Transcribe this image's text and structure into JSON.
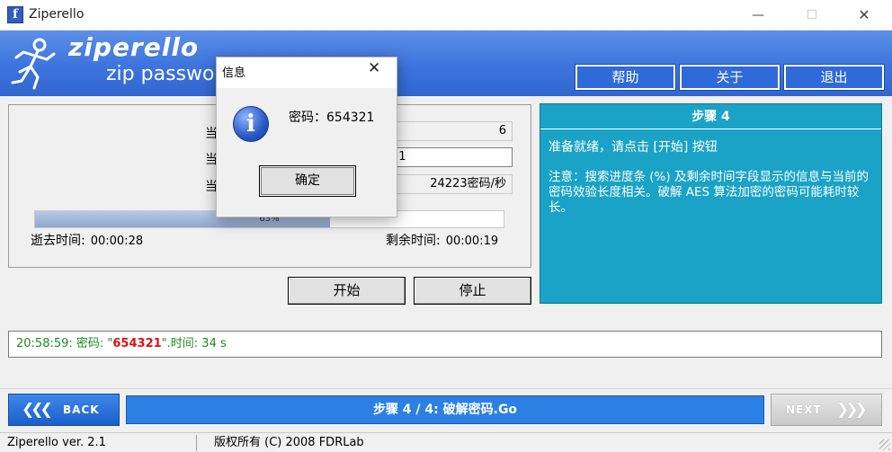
{
  "window": {
    "title": "Ziperello",
    "minimize": "—",
    "maximize": "☐",
    "close": "✕"
  },
  "header": {
    "logo": "ziperello",
    "tagline": "zip password",
    "buttons": {
      "help": "帮助",
      "about": "关于",
      "exit": "退出"
    }
  },
  "stats": {
    "row1_label": "当",
    "row1_value": "6",
    "row2_label": "当",
    "row2_value": "21",
    "row3_label": "当",
    "row3_value": "24223密码/秒",
    "progress_text": "63%",
    "progress_value": 0.63,
    "elapsed_label": "逝去时间:",
    "elapsed_value": "00:00:28",
    "remaining_label": "剩余时间:",
    "remaining_value": "00:00:19"
  },
  "actions": {
    "start": "开始",
    "stop": "停止"
  },
  "step_panel": {
    "title": "步骤 4",
    "instruction": "准备就绪，请点击 [开始] 按钮",
    "note": "注意：搜索进度条 (%) 及剩余时间字段显示的信息与当前的密码效验长度相关。破解 AES 算法加密的密码可能耗时较长。"
  },
  "log": {
    "time": "20:58:59:",
    "prefix": " 密码: \"",
    "password": "654321",
    "suffix": "\".时间: 34 s"
  },
  "nav": {
    "back": "BACK",
    "back_arrows": "❮❮❮",
    "step": "步骤 4 / 4: 破解密码.Go",
    "next": "NEXT",
    "next_arrows": "❯❯❯"
  },
  "status": {
    "version": "Ziperello ver. 2.1",
    "copyright": "版权所有 (C) 2008 FDRLab"
  },
  "dialog": {
    "title": "信息",
    "close": "✕",
    "icon": "info-icon",
    "message": "密码：654321",
    "ok": "确定"
  },
  "colors": {
    "banner": "#3d74dd",
    "step_panel": "#1aa3c6",
    "step_bar": "#2d80e3",
    "log_text": "#1c8a1c",
    "log_password": "#e01010"
  }
}
